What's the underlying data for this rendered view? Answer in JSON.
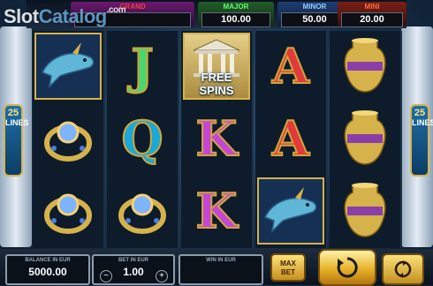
{
  "watermark": {
    "part1": "Slot",
    "part2": "Catalog",
    "suffix": ".com"
  },
  "jackpots": {
    "grand": {
      "label": "GRAND",
      "value": ""
    },
    "major": {
      "label": "MAJOR",
      "value": "100.00"
    },
    "minor": {
      "label": "MINOR",
      "value": "50.00"
    },
    "mini": {
      "label": "MINI",
      "value": "20.00"
    }
  },
  "lines_badge": {
    "count": "25",
    "word": "LINES"
  },
  "reels": [
    [
      "dolphin-symbol",
      "ring-symbol",
      "ring-symbol"
    ],
    [
      "J",
      "Q",
      "ring-symbol"
    ],
    [
      "free-spins-symbol",
      "K",
      "K"
    ],
    [
      "A",
      "A",
      "dolphin-symbol"
    ],
    [
      "vase-symbol",
      "vase-symbol",
      "vase-symbol"
    ]
  ],
  "free_spins_label": "FREE SPINS",
  "console": {
    "balance": {
      "label": "BALANCE IN EUR",
      "value": "5000.00"
    },
    "bet": {
      "label": "BET IN EUR",
      "value": "1.00",
      "minus": "−",
      "plus": "+"
    },
    "win": {
      "label": "WIN IN EUR",
      "value": ""
    },
    "max_bet": {
      "line1": "MAX",
      "line2": "BET"
    }
  },
  "colors": {
    "gold": "#d6b24a",
    "grand": "#ff3b3b",
    "major": "#5cff6e",
    "minor": "#8fd0ff",
    "mini": "#ff6a3d"
  }
}
